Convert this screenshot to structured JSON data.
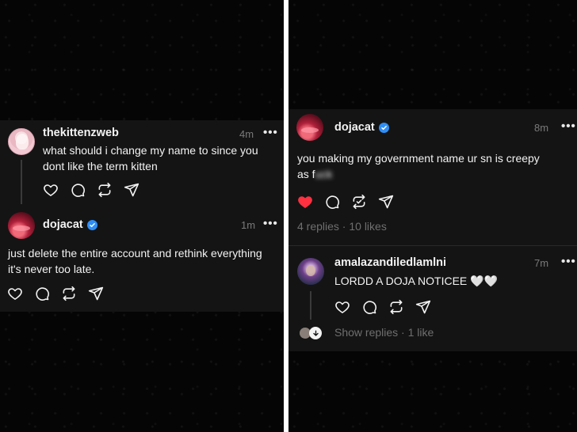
{
  "left_post": {
    "parent": {
      "username": "thekittenzweb",
      "time": "4m",
      "more_label": "•••",
      "text_line1": "what should i change my name to since you",
      "text_line2": "dont like the term kitten"
    },
    "reply": {
      "username": "dojacat",
      "verified": true,
      "time": "1m",
      "more_label": "•••",
      "text_line1": "just delete the entire account and rethink everything",
      "text_line2": "it's never too late."
    }
  },
  "right_post": {
    "main": {
      "username": "dojacat",
      "verified": true,
      "time": "8m",
      "more_label": "•••",
      "text_line1": "you making my government name ur sn is creepy",
      "text_line2_prefix": "as f",
      "text_line2_censored": "uck",
      "liked": true,
      "stats": "4 replies · 10 likes"
    },
    "reply": {
      "username": "amalazandiledlamlni",
      "time": "7m",
      "more_label": "•••",
      "text": "LORDD A DOJA NOTICEE 🤍🤍",
      "show_replies": "Show replies · 1 like"
    }
  },
  "colors": {
    "background": "#050505",
    "card": "#141414",
    "heart_liked": "#ff3040",
    "verified": "#2f8ef7",
    "muted": "#6f6f6f"
  },
  "icons": [
    "heart-icon",
    "comment-icon",
    "repost-icon",
    "share-icon",
    "verified-icon",
    "more-icon"
  ]
}
